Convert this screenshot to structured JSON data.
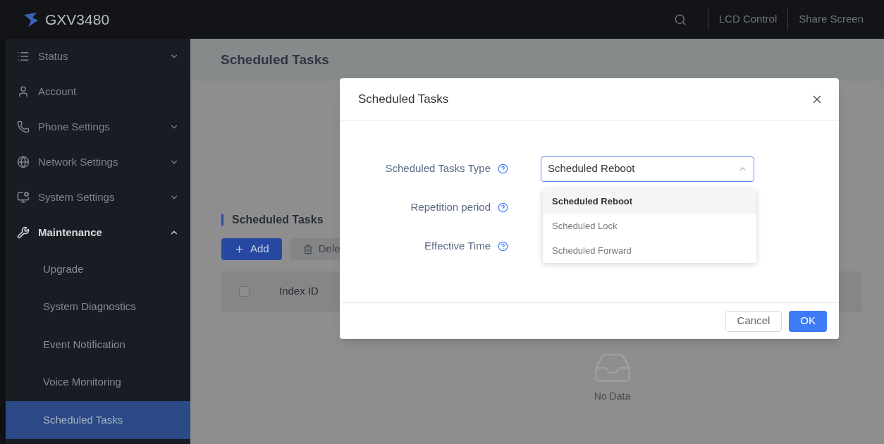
{
  "header": {
    "brand": "GXV3480",
    "actions": [
      "LCD Control",
      "Share Screen"
    ]
  },
  "sidebar": {
    "items": [
      {
        "label": "Status",
        "expanded": false
      },
      {
        "label": "Account"
      },
      {
        "label": "Phone Settings",
        "expanded": false
      },
      {
        "label": "Network Settings",
        "expanded": false
      },
      {
        "label": "System Settings",
        "expanded": false
      },
      {
        "label": "Maintenance",
        "expanded": true,
        "children": [
          {
            "label": "Upgrade",
            "selected": false
          },
          {
            "label": "System Diagnostics",
            "selected": false
          },
          {
            "label": "Event Notification",
            "selected": false
          },
          {
            "label": "Voice Monitoring",
            "selected": false
          },
          {
            "label": "Scheduled Tasks",
            "selected": true
          }
        ]
      }
    ]
  },
  "page": {
    "title": "Scheduled Tasks",
    "section_title": "Scheduled Tasks",
    "buttons": [
      {
        "label": "Add",
        "kind": "primary"
      },
      {
        "label": "Dele",
        "kind": "delete"
      }
    ],
    "table": {
      "columns": [
        "Index ID"
      ],
      "select_all_checked": false,
      "empty_text": "No Data"
    }
  },
  "dialog": {
    "title": "Scheduled Tasks",
    "fields": [
      {
        "label": "Scheduled Tasks Type",
        "value": "Scheduled Reboot",
        "kind": "select",
        "expanded": true
      },
      {
        "label": "Repetition period",
        "kind": "hidden"
      },
      {
        "label": "Effective Time",
        "kind": "hidden"
      }
    ],
    "options": [
      {
        "label": "Scheduled Reboot",
        "selected": true
      },
      {
        "label": "Scheduled Lock",
        "selected": false
      },
      {
        "label": "Scheduled Forward",
        "selected": false
      }
    ],
    "buttons": [
      {
        "label": "Cancel",
        "kind": "secondary"
      },
      {
        "label": "OK",
        "kind": "primary"
      }
    ]
  }
}
